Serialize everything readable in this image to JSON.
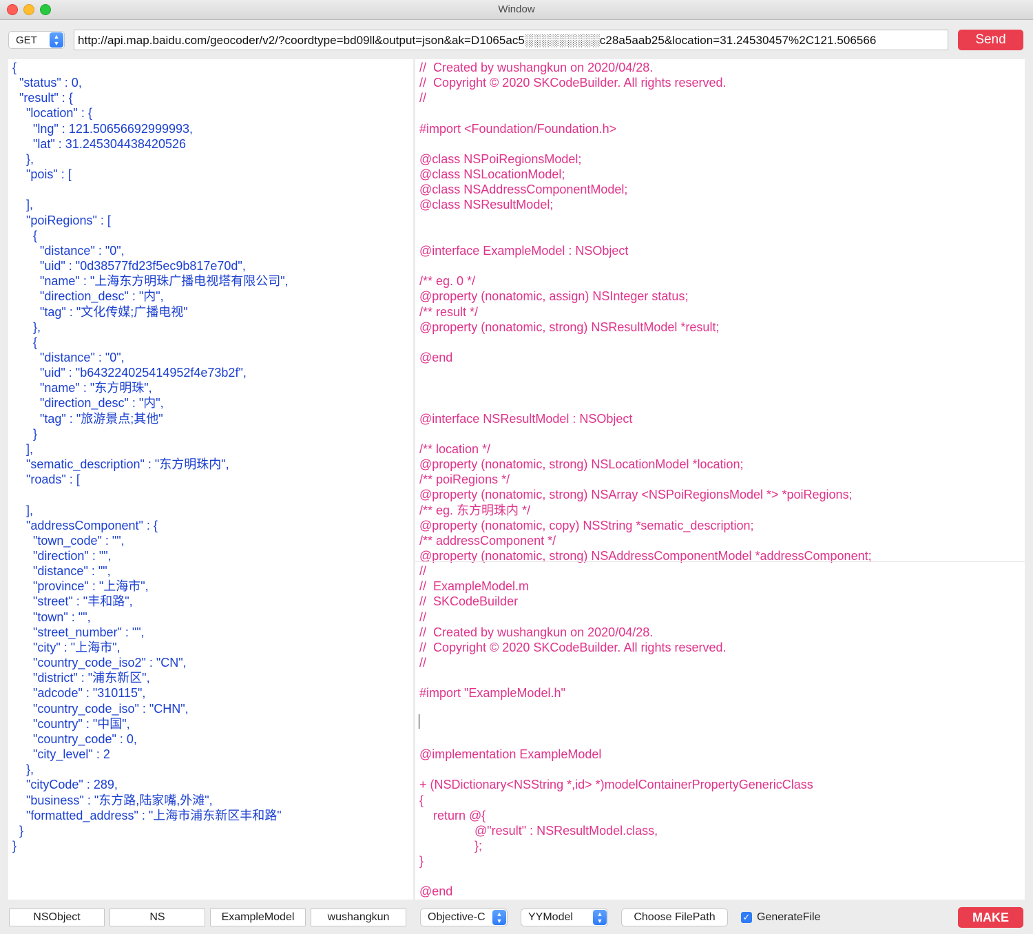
{
  "window": {
    "title": "Window"
  },
  "request": {
    "method": "GET",
    "url": "http://api.map.baidu.com/geocoder/v2/?coordtype=bd09ll&output=json&ak=D1065ac5░░░░░░░░░c28a5aab25&location=31.24530457%2C121.506566",
    "send_label": "Send"
  },
  "json_text": "{\n  \"status\" : 0,\n  \"result\" : {\n    \"location\" : {\n      \"lng\" : 121.50656692999993,\n      \"lat\" : 31.245304438420526\n    },\n    \"pois\" : [\n\n    ],\n    \"poiRegions\" : [\n      {\n        \"distance\" : \"0\",\n        \"uid\" : \"0d38577fd23f5ec9b817e70d\",\n        \"name\" : \"上海东方明珠广播电视塔有限公司\",\n        \"direction_desc\" : \"内\",\n        \"tag\" : \"文化传媒;广播电视\"\n      },\n      {\n        \"distance\" : \"0\",\n        \"uid\" : \"b643224025414952f4e73b2f\",\n        \"name\" : \"东方明珠\",\n        \"direction_desc\" : \"内\",\n        \"tag\" : \"旅游景点;其他\"\n      }\n    ],\n    \"sematic_description\" : \"东方明珠内\",\n    \"roads\" : [\n\n    ],\n    \"addressComponent\" : {\n      \"town_code\" : \"\",\n      \"direction\" : \"\",\n      \"distance\" : \"\",\n      \"province\" : \"上海市\",\n      \"street\" : \"丰和路\",\n      \"town\" : \"\",\n      \"street_number\" : \"\",\n      \"city\" : \"上海市\",\n      \"country_code_iso2\" : \"CN\",\n      \"district\" : \"浦东新区\",\n      \"adcode\" : \"310115\",\n      \"country_code_iso\" : \"CHN\",\n      \"country\" : \"中国\",\n      \"country_code\" : 0,\n      \"city_level\" : 2\n    },\n    \"cityCode\" : 289,\n    \"business\" : \"东方路,陆家嘴,外滩\",\n    \"formatted_address\" : \"上海市浦东新区丰和路\"\n  }\n}",
  "objc_text": "//  Created by wushangkun on 2020/04/28.\n//  Copyright © 2020 SKCodeBuilder. All rights reserved.\n//\n\n#import <Foundation/Foundation.h>\n\n@class NSPoiRegionsModel;\n@class NSLocationModel;\n@class NSAddressComponentModel;\n@class NSResultModel;\n\n\n@interface ExampleModel : NSObject\n\n/** eg. 0 */\n@property (nonatomic, assign) NSInteger status;\n/** result */\n@property (nonatomic, strong) NSResultModel *result;\n\n@end\n\n\n\n@interface NSResultModel : NSObject\n\n/** location */\n@property (nonatomic, strong) NSLocationModel *location;\n/** poiRegions */\n@property (nonatomic, strong) NSArray <NSPoiRegionsModel *> *poiRegions;\n/** eg. 东方明珠内 */\n@property (nonatomic, copy) NSString *sematic_description;\n/** addressComponent */\n@property (nonatomic, strong) NSAddressComponentModel *addressComponent;\n//\n//  ExampleModel.m\n//  SKCodeBuilder\n//\n//  Created by wushangkun on 2020/04/28.\n//  Copyright © 2020 SKCodeBuilder. All rights reserved.\n//\n\n#import \"ExampleModel.h\"\n\n\n\n@implementation ExampleModel\n\n+ (NSDictionary<NSString *,id> *)modelContainerPropertyGenericClass\n{\n    return @{\n                @\"result\" : NSResultModel.class,\n                };\n}\n\n@end",
  "bottom": {
    "super_class": "NSObject",
    "prefix": "NS",
    "model_name": "ExampleModel",
    "author": "wushangkun",
    "language": "Objective-C",
    "framework": "YYModel",
    "choose_path_label": "Choose FilePath",
    "generate_file_label": "GenerateFile",
    "generate_file_checked": true,
    "make_label": "MAKE"
  },
  "colors": {
    "json_text": "#1a3fd0",
    "objc_text": "#e0338a",
    "accent_button": "#ea3d4e",
    "stepper": "#2f7cf6"
  }
}
